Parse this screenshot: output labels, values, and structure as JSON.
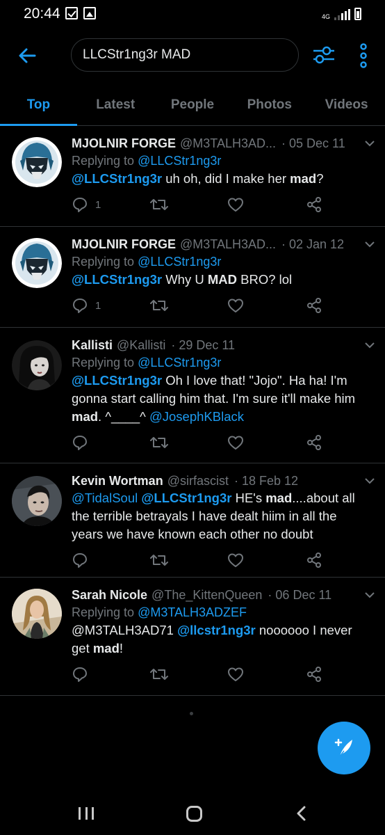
{
  "status_bar": {
    "time": "20:44",
    "network": "4G"
  },
  "search": {
    "query": "LLCStr1ng3r MAD"
  },
  "tabs": [
    {
      "label": "Top",
      "active": true
    },
    {
      "label": "Latest",
      "active": false
    },
    {
      "label": "People",
      "active": false
    },
    {
      "label": "Photos",
      "active": false
    },
    {
      "label": "Videos",
      "active": false
    }
  ],
  "tweets": [
    {
      "name": "MJOLNIR FORGE",
      "handle": "@M3TALH3AD...",
      "date": "05 Dec 11",
      "replying_prefix": "Replying to",
      "replying_to": "@LLCStr1ng3r",
      "text_parts": [
        "@LLCStr1ng3r",
        " uh oh, did I make her ",
        "mad",
        "?"
      ],
      "reply_count": "1"
    },
    {
      "name": "MJOLNIR FORGE",
      "handle": "@M3TALH3AD...",
      "date": "02 Jan 12",
      "replying_prefix": "Replying to",
      "replying_to": "@LLCStr1ng3r",
      "text_parts": [
        "@LLCStr1ng3r",
        " Why U ",
        "MAD",
        " BRO? lol"
      ],
      "reply_count": "1"
    },
    {
      "name": "Kallisti",
      "handle": "@Kallisti",
      "date": "29 Dec 11",
      "replying_prefix": "Replying to",
      "replying_to": "@LLCStr1ng3r",
      "text_parts": [
        "@LLCStr1ng3r",
        " Oh I love that! \"Jojo\". Ha ha! I'm gonna start calling him that. I'm sure it'll make him ",
        "mad",
        ". ^____^ ",
        "@JosephKBlack"
      ],
      "reply_count": ""
    },
    {
      "name": "Kevin Wortman",
      "handle": "@sirfascist",
      "date": "18 Feb 12",
      "text_parts": [
        "@TidalSoul",
        " ",
        "@LLCStr1ng3r",
        " HE's ",
        "mad",
        "....about all the terrible betrayals I have dealt hiim in all the years we have known each other no doubt"
      ],
      "reply_count": ""
    },
    {
      "name": "Sarah Nicole",
      "handle": "@The_KittenQueen",
      "date": "06 Dec 11",
      "replying_prefix": "Replying to",
      "replying_to": "@M3TALH3ADZEF",
      "text_parts": [
        "@M3TALH3AD71 ",
        "@llcstr1ng3r",
        " noooooo I never get ",
        "mad",
        "!"
      ],
      "reply_count": ""
    }
  ],
  "colors": {
    "accent": "#1d9bf0",
    "background": "#000000",
    "muted": "#71767b",
    "divider": "#2f3336"
  },
  "icons": {
    "back": "arrow-left-icon",
    "filter": "sliders-icon",
    "more": "more-vertical-icon",
    "reply": "reply-icon",
    "retweet": "retweet-icon",
    "like": "heart-icon",
    "share": "share-icon",
    "compose": "compose-icon"
  }
}
